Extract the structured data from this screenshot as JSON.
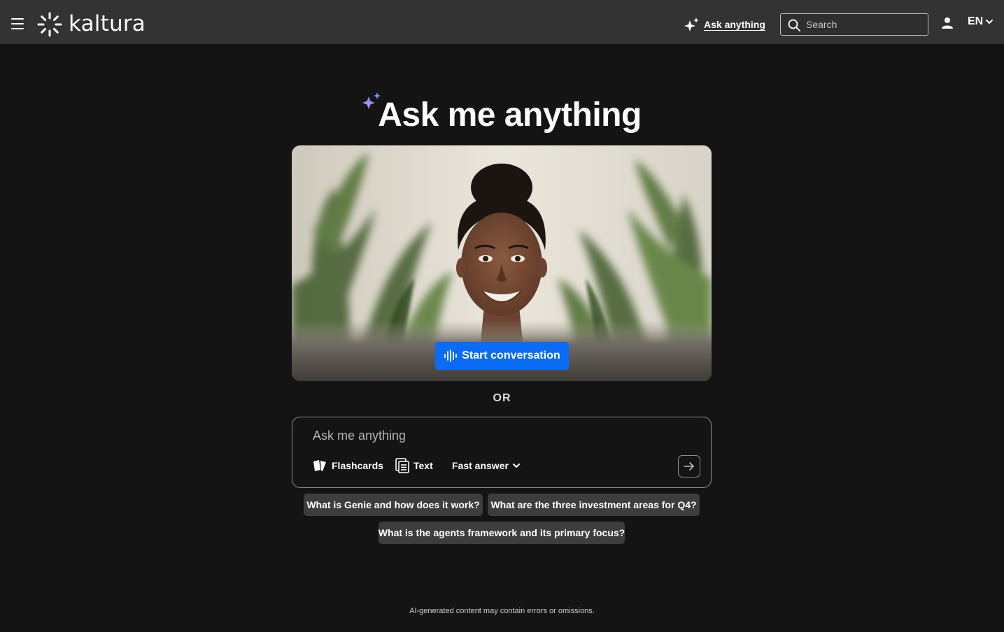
{
  "header": {
    "brand": "kaltura",
    "ask_link": "Ask anything",
    "search_placeholder": "Search",
    "language": "EN"
  },
  "hero": {
    "title": "Ask me anything",
    "start_button": "Start conversation",
    "or_label": "OR"
  },
  "ask_box": {
    "placeholder": "Ask me anything",
    "tools": {
      "flashcards": "Flashcards",
      "text": "Text",
      "mode": "Fast answer"
    }
  },
  "suggestions": [
    "What is Genie and how does it work?",
    "What are the three investment areas for Q4?",
    "What is the agents framework and its primary focus?"
  ],
  "footer": {
    "disclaimer": "AI-generated content may contain errors or omissions."
  },
  "colors": {
    "background": "#141414",
    "header": "#333333",
    "primary_button": "#0a6cf5",
    "chip": "#3d3d3d"
  }
}
